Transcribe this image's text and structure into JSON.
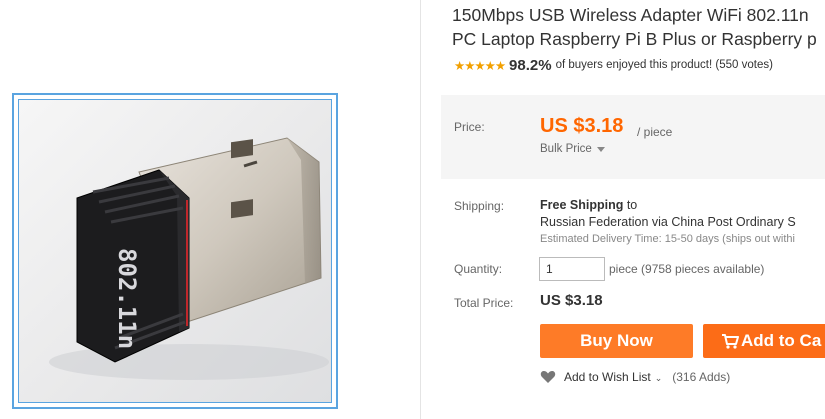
{
  "product": {
    "title_line1": "150Mbps USB Wireless Adapter WiFi 802.11n",
    "title_line2": "PC Laptop Raspberry Pi B Plus or Raspberry p",
    "image_text": "802.11n"
  },
  "rating": {
    "stars": "★★★★★",
    "percent": "98.2%",
    "summary": "of buyers enjoyed this product! (550 votes)"
  },
  "price": {
    "label": "Price:",
    "value": "US $3.18",
    "unit": "/ piece",
    "bulk_label": "Bulk Price"
  },
  "shipping": {
    "label": "Shipping:",
    "free": "Free Shipping",
    "to": "to",
    "destination": "Russian Federation via China Post Ordinary S",
    "delivery": "Estimated Delivery Time: 15-50 days (ships out withi"
  },
  "quantity": {
    "label": "Quantity:",
    "value": "1",
    "note": "piece (9758 pieces available)"
  },
  "total": {
    "label": "Total Price:",
    "value": "US $3.18"
  },
  "actions": {
    "buy_now": "Buy Now",
    "add_to_cart": "Add to Ca",
    "wish_list": "Add to Wish List",
    "wish_count": "(316 Adds)"
  },
  "colors": {
    "price": "#ff6600",
    "buy_button": "#fe7b27",
    "cart_button": "#fc6c17",
    "stars": "#f2a000",
    "image_border": "#5aa4e0"
  }
}
